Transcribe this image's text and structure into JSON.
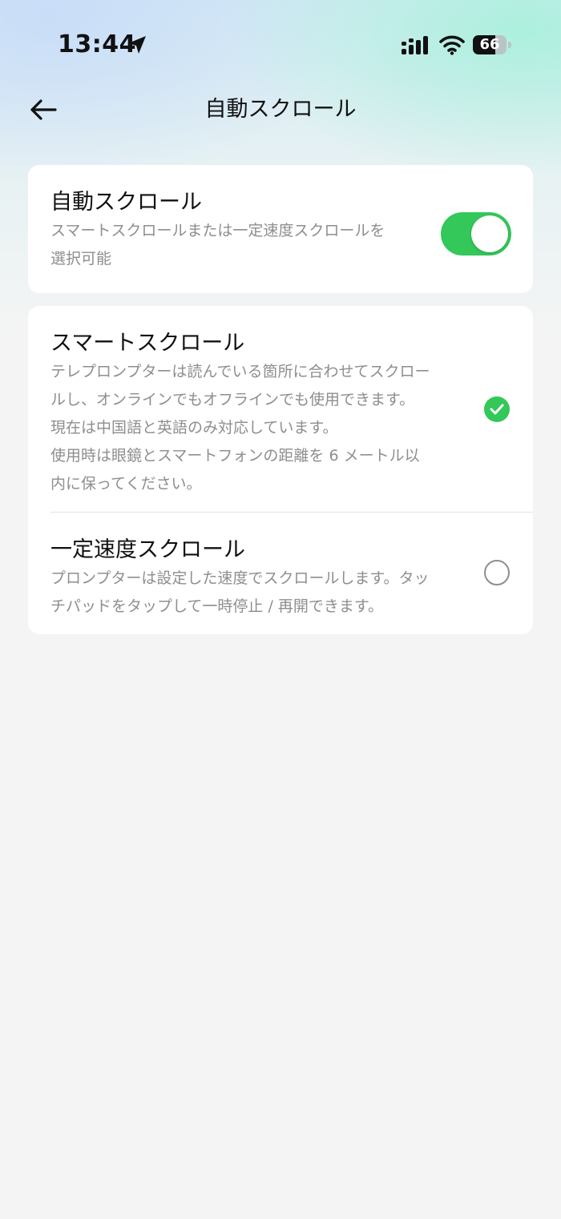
{
  "status_bar": {
    "time": "13:44",
    "battery_percent": "66"
  },
  "nav": {
    "title": "自動スクロール"
  },
  "auto_scroll": {
    "title": "自動スクロール",
    "desc_lines": [
      "スマートスクロールまたは一定速度スクロールを",
      "選択可能"
    ],
    "enabled": true
  },
  "modes": [
    {
      "title": "スマートスクロール",
      "desc_lines": [
        "テレプロンプターは読んでいる箇所に合わせてスクロー",
        "ルし、オンラインでもオフラインでも使用できます。",
        "現在は中国語と英語のみ対応しています。",
        "使用時は眼鏡とスマートフォンの距離を 6 メートル以",
        "内に保ってください。"
      ],
      "selected": true
    },
    {
      "title": "一定速度スクロール",
      "desc_lines": [
        "プロンプターは設定した速度でスクロールします。タッ",
        "チパッドをタップして一時停止 / 再開できます。"
      ],
      "selected": false
    }
  ],
  "colors": {
    "accent_green": "#34c759",
    "secondary_text": "#8e8e8e"
  }
}
